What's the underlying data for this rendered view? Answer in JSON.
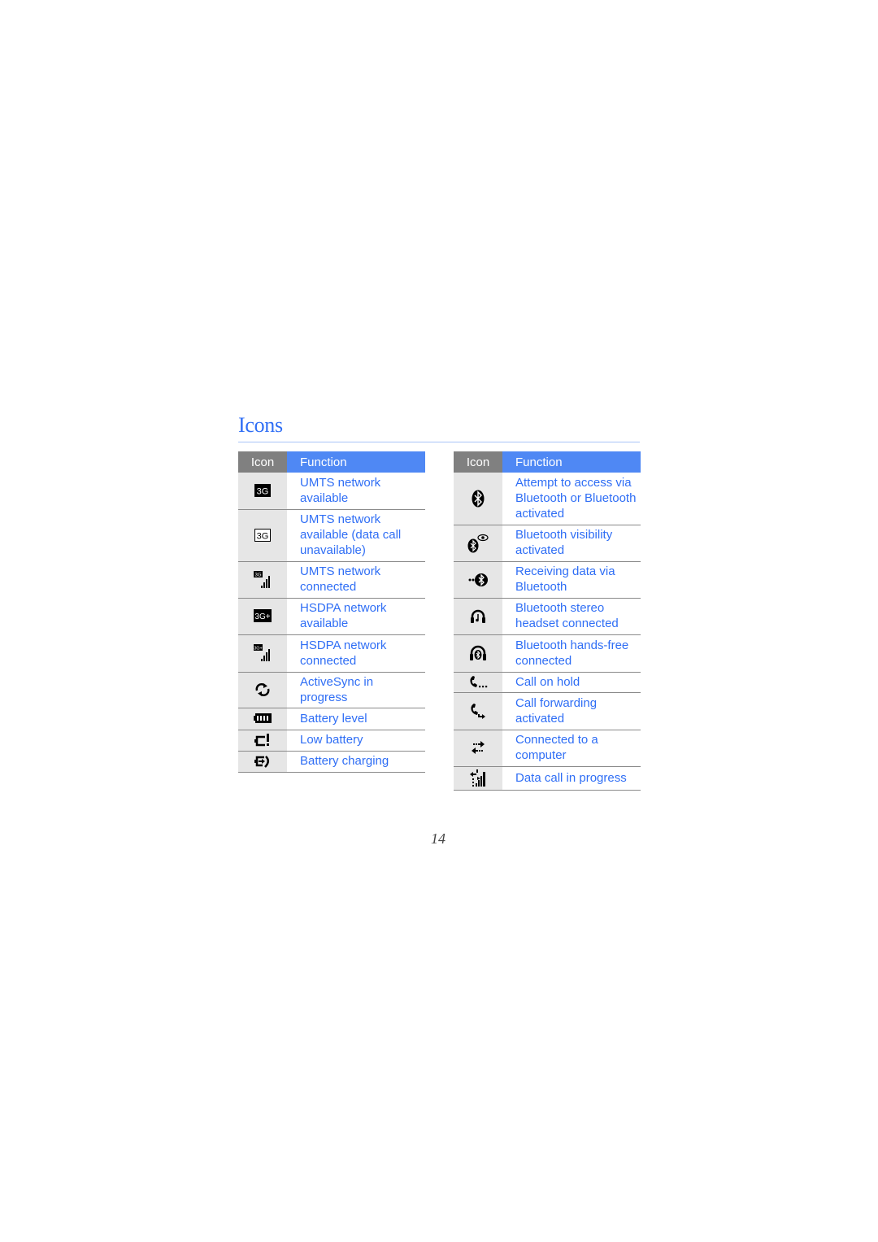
{
  "page": {
    "title": "Icons",
    "page_number": "14"
  },
  "colors": {
    "title": "#2f6ef5",
    "header_icon_bg": "#808080",
    "header_function_bg": "#4f88f4",
    "icon_cell_bg": "#e6e6e6",
    "function_text": "#2f6ef5"
  },
  "tables": [
    {
      "headers": {
        "icon": "Icon",
        "function": "Function"
      },
      "rows": [
        {
          "icon": "umts-3g-filled-icon",
          "function": "UMTS network available"
        },
        {
          "icon": "umts-3g-outline-icon",
          "function": "UMTS network available (data call unavailable)"
        },
        {
          "icon": "umts-connected-signal-icon",
          "function": "UMTS network connected"
        },
        {
          "icon": "hsdpa-3g-plus-icon",
          "function": "HSDPA network available"
        },
        {
          "icon": "hsdpa-connected-signal-icon",
          "function": "HSDPA network connected"
        },
        {
          "icon": "activesync-icon",
          "function": "ActiveSync in progress"
        },
        {
          "icon": "battery-level-icon",
          "function": "Battery level"
        },
        {
          "icon": "low-battery-icon",
          "function": "Low battery"
        },
        {
          "icon": "battery-charging-icon",
          "function": "Battery charging"
        }
      ]
    },
    {
      "headers": {
        "icon": "Icon",
        "function": "Function"
      },
      "rows": [
        {
          "icon": "bluetooth-icon",
          "function": "Attempt to access via Bluetooth or Bluetooth activated"
        },
        {
          "icon": "bluetooth-visibility-icon",
          "function": "Bluetooth visibility activated"
        },
        {
          "icon": "bluetooth-receiving-icon",
          "function": "Receiving data via Bluetooth"
        },
        {
          "icon": "bluetooth-stereo-headset-icon",
          "function": "Bluetooth stereo headset connected"
        },
        {
          "icon": "bluetooth-handsfree-icon",
          "function": "Bluetooth hands-free connected"
        },
        {
          "icon": "call-on-hold-icon",
          "function": "Call on hold"
        },
        {
          "icon": "call-forwarding-icon",
          "function": "Call forwarding activated"
        },
        {
          "icon": "pc-connection-icon",
          "function": "Connected to a computer"
        },
        {
          "icon": "data-call-icon",
          "function": "Data call in progress"
        }
      ]
    }
  ]
}
